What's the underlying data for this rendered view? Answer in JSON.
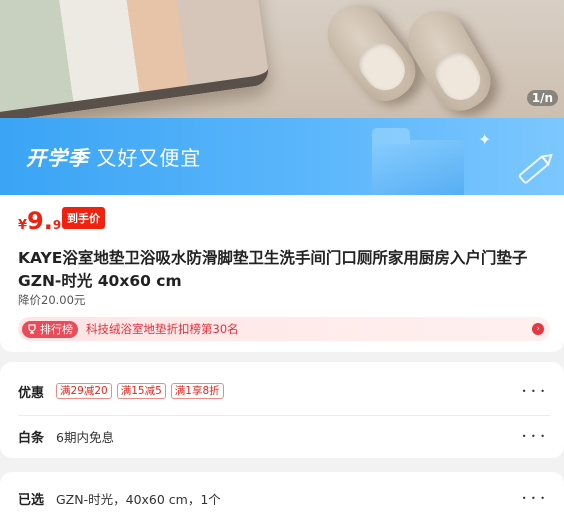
{
  "hero": {
    "scale_tag": "1/n"
  },
  "banner": {
    "text_em": "开学季",
    "text_rest": "又好又便宜"
  },
  "price": {
    "symbol": "¥",
    "integer": "9.",
    "decimal": "90",
    "badge": "到手价"
  },
  "product": {
    "title": "KAYE浴室地垫卫浴吸水防滑脚垫卫生洗手间门口厕所家用厨房入户门垫子GZN-时光 40x60 cm",
    "original_price": "降价20.00元"
  },
  "ranking": {
    "tag": "排行榜",
    "text": "科技绒浴室地垫折扣榜第30名"
  },
  "promotions": {
    "label": "优惠",
    "coupons": [
      "满29减20",
      "满15减5",
      "满1享8折"
    ],
    "more": "• • •"
  },
  "baitiao": {
    "label": "白条",
    "text": "6期内免息",
    "more": "• • •"
  },
  "selected": {
    "label": "已选",
    "text": "GZN-时光，40x60 cm，1个",
    "more": "• • •"
  },
  "colors": {
    "accent_red": "#f0210f",
    "banner_blue": "#3aa4f5"
  }
}
